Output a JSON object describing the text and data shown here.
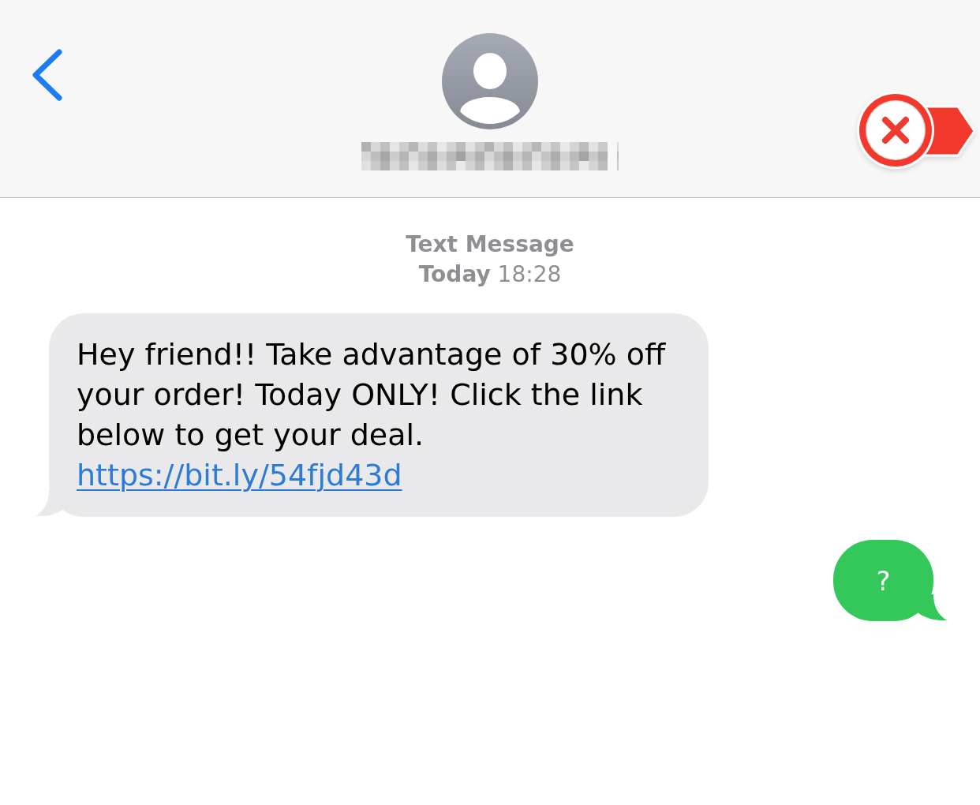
{
  "thread_header": {
    "service": "Text Message",
    "time": "**Today** 18:28"
  },
  "messages": [
    {
      "kind": "received",
      "text": "Hey friend!! Take advantage of 30% off your order! Today ONLY! Click the link below to get your deal.",
      "link": "https://bit.ly/54fjd43d"
    },
    {
      "kind": "sent",
      "text": "?"
    }
  ]
}
